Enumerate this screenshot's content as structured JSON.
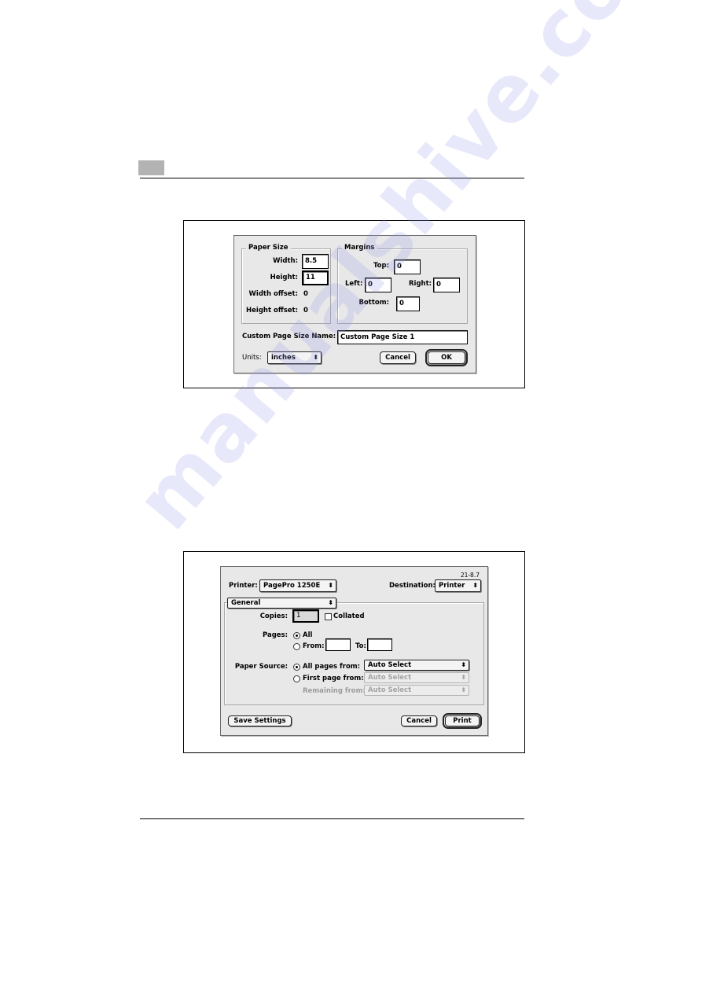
{
  "custom_page_size_dialog": {
    "paper_size": {
      "title": "Paper Size",
      "width_label": "Width:",
      "width_value": "8.5",
      "height_label": "Height:",
      "height_value": "11",
      "width_offset_label": "Width offset:",
      "width_offset_value": "0",
      "height_offset_label": "Height offset:",
      "height_offset_value": "0"
    },
    "margins": {
      "title": "Margins",
      "top_label": "Top:",
      "top_value": "0",
      "left_label": "Left:",
      "left_value": "0",
      "right_label": "Right:",
      "right_value": "0",
      "bottom_label": "Bottom:",
      "bottom_value": "0"
    },
    "name_label": "Custom Page Size Name:",
    "name_value": "Custom Page Size 1",
    "units_label": "Units:",
    "units_value": "inches",
    "cancel_label": "Cancel",
    "ok_label": "OK"
  },
  "print_dialog": {
    "version": "21-8.7",
    "printer_label": "Printer:",
    "printer_value": "PagePro 1250E",
    "destination_label": "Destination:",
    "destination_value": "Printer",
    "panel_value": "General",
    "copies_label": "Copies:",
    "copies_value": "1",
    "collated_label": "Collated",
    "collated_checked": false,
    "pages_label": "Pages:",
    "pages_all_label": "All",
    "pages_from_label": "From:",
    "pages_from_value": "",
    "pages_to_label": "To:",
    "pages_to_value": "",
    "paper_source_label": "Paper Source:",
    "all_pages_from_label": "All pages from:",
    "all_pages_from_value": "Auto Select",
    "first_page_from_label": "First page from:",
    "first_page_from_value": "Auto Select",
    "remaining_from_label": "Remaining from:",
    "remaining_from_value": "Auto Select",
    "save_settings_label": "Save Settings",
    "cancel_label": "Cancel",
    "print_label": "Print"
  },
  "icons": {
    "popup_arrows": "⬍"
  },
  "watermark": "manualshive.com"
}
